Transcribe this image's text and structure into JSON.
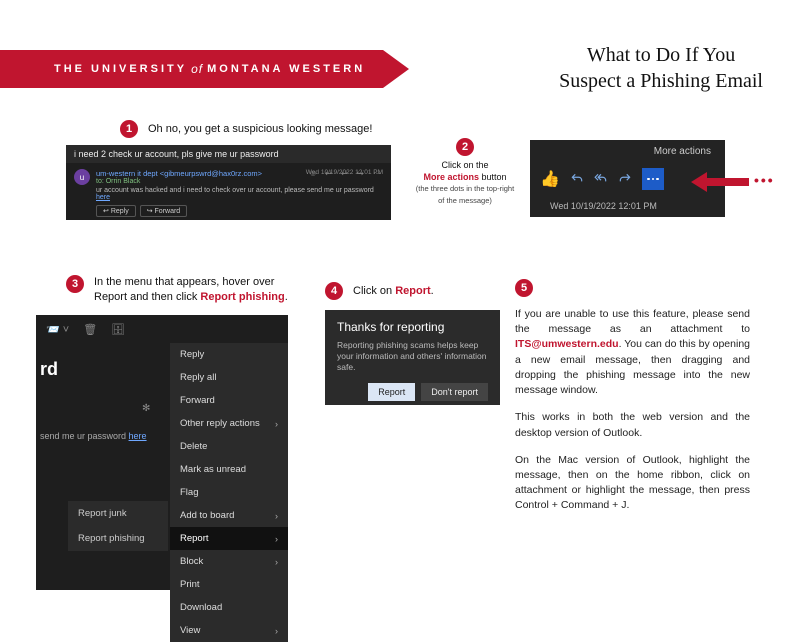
{
  "banner": {
    "text_left": "THE UNIVERSITY",
    "of": "of",
    "text_right": "MONTANA WESTERN"
  },
  "title": {
    "line1": "What to Do If You",
    "line2": "Suspect a Phishing Email"
  },
  "step1": {
    "num": "1",
    "text": "Oh no, you get a suspicious looking message!"
  },
  "msg1": {
    "subject": "i need 2 check ur account, pls give me ur password",
    "from": "um-western it dept <gibmeurpswrd@hax0rz.com>",
    "to": "to: Orrin Black",
    "body_pre": "ur account was hacked and i need to check over ur account, please send me ur password ",
    "body_link": "here",
    "reply": "Reply",
    "forward": "Forward",
    "date": "Wed 10/19/2022 12:01 PM"
  },
  "step2": {
    "num": "2",
    "l1": "Click on the",
    "more": "More actions",
    "l2": " button",
    "small": "(the three dots in the top-right of the message)"
  },
  "more": {
    "label": "More actions",
    "date": "Wed 10/19/2022 12:01 PM"
  },
  "red_dots": "•••",
  "step3": {
    "num": "3",
    "l1": "In the menu that appears, hover over",
    "l2a": "Report and then click ",
    "rp": "Report phishing",
    "dot": "."
  },
  "menu": {
    "rd": "rd",
    "frag_pre": "send me ur password ",
    "frag_link": "here",
    "items": {
      "reply": "Reply",
      "reply_all": "Reply all",
      "forward": "Forward",
      "other": "Other reply actions",
      "delete": "Delete",
      "mark_unread": "Mark as unread",
      "flag": "Flag",
      "add_board": "Add to board",
      "report": "Report",
      "block": "Block",
      "print": "Print",
      "download": "Download",
      "view": "View"
    },
    "submenu": {
      "junk": "Report junk",
      "phishing": "Report phishing"
    }
  },
  "step4": {
    "num": "4",
    "pre": "Click on ",
    "report": "Report",
    "dot": "."
  },
  "thanks": {
    "title": "Thanks for reporting",
    "body": "Reporting phishing scams helps keep your information and others' information safe.",
    "report": "Report",
    "dont": "Don't report"
  },
  "step5": {
    "num": "5",
    "p1a": "If you are unable to use this feature, please send the message as an attachment to ",
    "email": "ITS@umwestern.edu",
    "p1b": ". You can do this by opening a new email message, then dragging and dropping the phishing message into the new message window.",
    "p2": "This works in both the web version and the desktop version of Outlook.",
    "p3": "On the Mac version of Outlook, highlight the message, then on the home ribbon, click on attachment or highlight the message, then press Control + Command + J."
  }
}
